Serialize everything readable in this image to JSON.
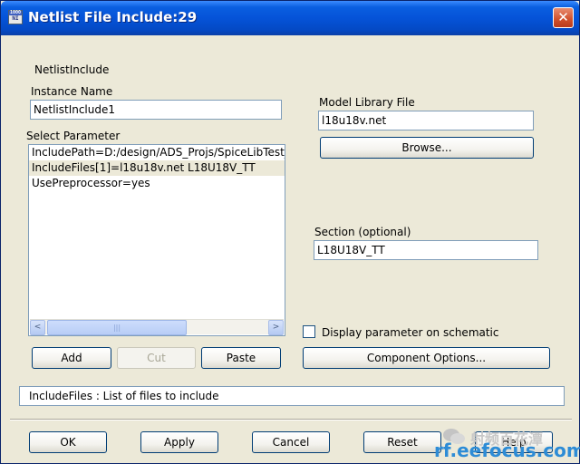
{
  "window": {
    "title": "Netlist File Include:29",
    "icon_name": "netlist-app-icon",
    "icon_top": "1000",
    "icon_main": "NI",
    "close_glyph": "✕"
  },
  "component_name": "NetlistInclude",
  "instance": {
    "label": "Instance Name",
    "value": "NetlistInclude1"
  },
  "parameters": {
    "label": "Select Parameter",
    "items": [
      "IncludePath=D:/design/ADS_Projs/SpiceLibTest_p",
      "IncludeFiles[1]=l18u18v.net L18U18V_TT",
      "UsePreprocessor=yes"
    ],
    "selected_index": 1,
    "scroll_left_glyph": "<",
    "scroll_right_glyph": ">",
    "scroll_grip": "|||"
  },
  "param_buttons": {
    "add": "Add",
    "cut": "Cut",
    "paste": "Paste"
  },
  "model_library": {
    "label": "Model Library File",
    "value": "l18u18v.net",
    "browse": "Browse..."
  },
  "section": {
    "label": "Section (optional)",
    "value": "L18U18V_TT"
  },
  "display_param": {
    "label": "Display parameter on schematic",
    "checked": false
  },
  "component_options": "Component Options...",
  "status": "IncludeFiles : List of files to include",
  "footer": {
    "ok": "OK",
    "apply": "Apply",
    "cancel": "Cancel",
    "reset": "Reset",
    "help": "Help"
  },
  "watermark": {
    "chinese": "射频百花潭",
    "url": "rf.eefocus.com"
  },
  "colors": {
    "titlebar": "#0553d8",
    "dialog_bg": "#ece9d8",
    "watermark_blue": "#2d8cd6"
  }
}
